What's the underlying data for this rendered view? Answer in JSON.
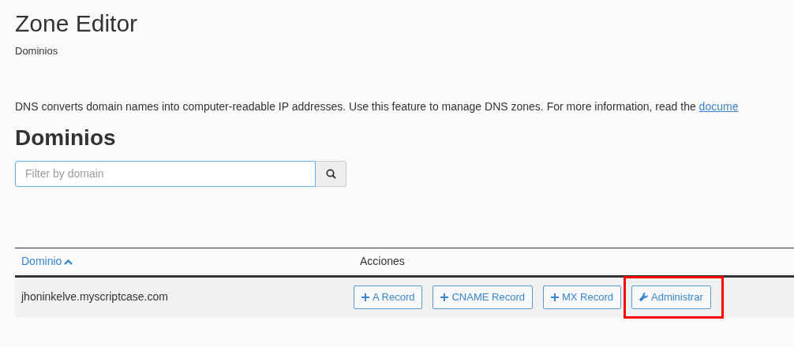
{
  "page_title": "Zone Editor",
  "breadcrumb": "Dominios",
  "description": {
    "text": "DNS converts domain names into computer-readable IP addresses. Use this feature to manage DNS zones. For more information, read the ",
    "link": "docume"
  },
  "section_title": "Dominios",
  "search": {
    "placeholder": "Filter by domain"
  },
  "table": {
    "columns": [
      {
        "label": "Dominio",
        "sorted": true
      },
      {
        "label": "Acciones",
        "sorted": false
      }
    ],
    "rows": [
      {
        "domain": "jhoninkelve.myscriptcase.com",
        "actions": [
          {
            "label": "A Record",
            "kind": "add",
            "highlighted": false
          },
          {
            "label": "CNAME Record",
            "kind": "add",
            "highlighted": false
          },
          {
            "label": "MX Record",
            "kind": "add",
            "highlighted": false
          },
          {
            "label": "Administrar",
            "kind": "manage",
            "highlighted": true
          }
        ]
      }
    ]
  }
}
